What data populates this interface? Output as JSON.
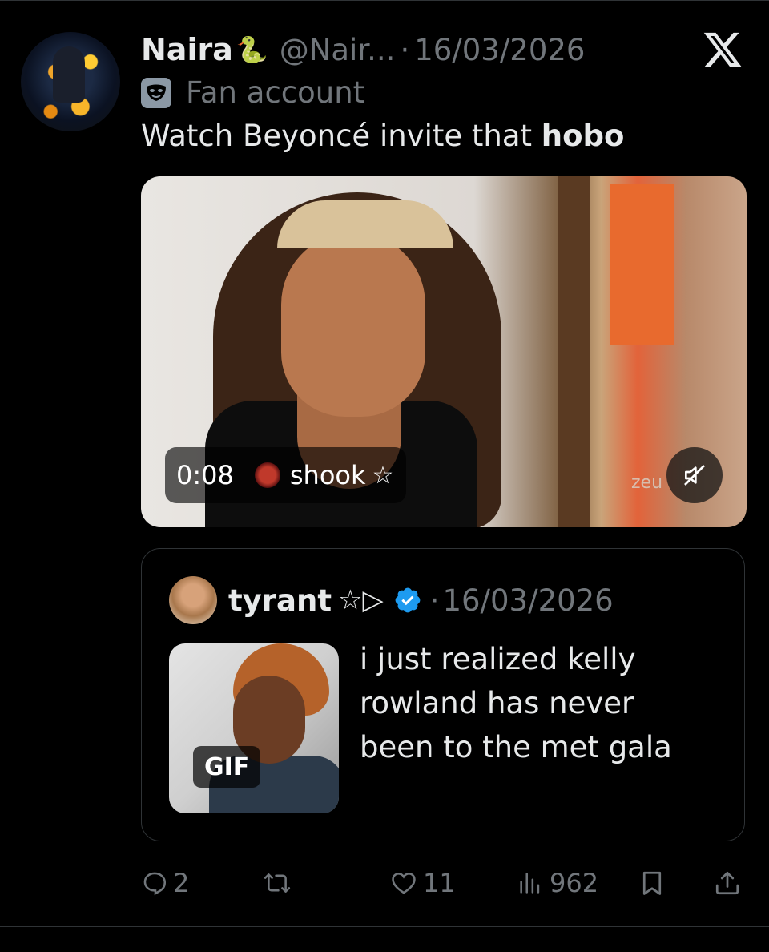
{
  "post": {
    "author_name": "Naira",
    "author_emoji": "🐍",
    "handle": "@Nair...",
    "separator": "·",
    "date": "16/03/2026",
    "label": "Fan account",
    "text_plain": "Watch Beyoncé invite that ",
    "text_bold": "hobo"
  },
  "media": {
    "time": "0:08",
    "uploader": "shook",
    "uploader_suffix": "☆",
    "watermark": "zeu"
  },
  "quote": {
    "author_name": "tyrant",
    "author_symbols": "☆▷",
    "separator": "·",
    "date": "16/03/2026",
    "gif_badge": "GIF",
    "text": "i just realized kelly rowland has never been to the met gala"
  },
  "actions": {
    "replies": "2",
    "reposts": "",
    "likes": "11",
    "views": "962"
  },
  "colors": {
    "background": "#000000",
    "primary_text": "#e7e9ea",
    "secondary_text": "#71767b",
    "verified_blue": "#1d9bf0",
    "border": "#2f3336"
  },
  "icons": {
    "x_logo": "x-logo-icon",
    "label": "mask-icon",
    "mute": "muted-speaker-icon",
    "verified": "verified-badge-icon",
    "reply": "reply-icon",
    "repost": "repost-icon",
    "like": "heart-icon",
    "views": "views-icon",
    "bookmark": "bookmark-icon",
    "share": "share-icon"
  }
}
